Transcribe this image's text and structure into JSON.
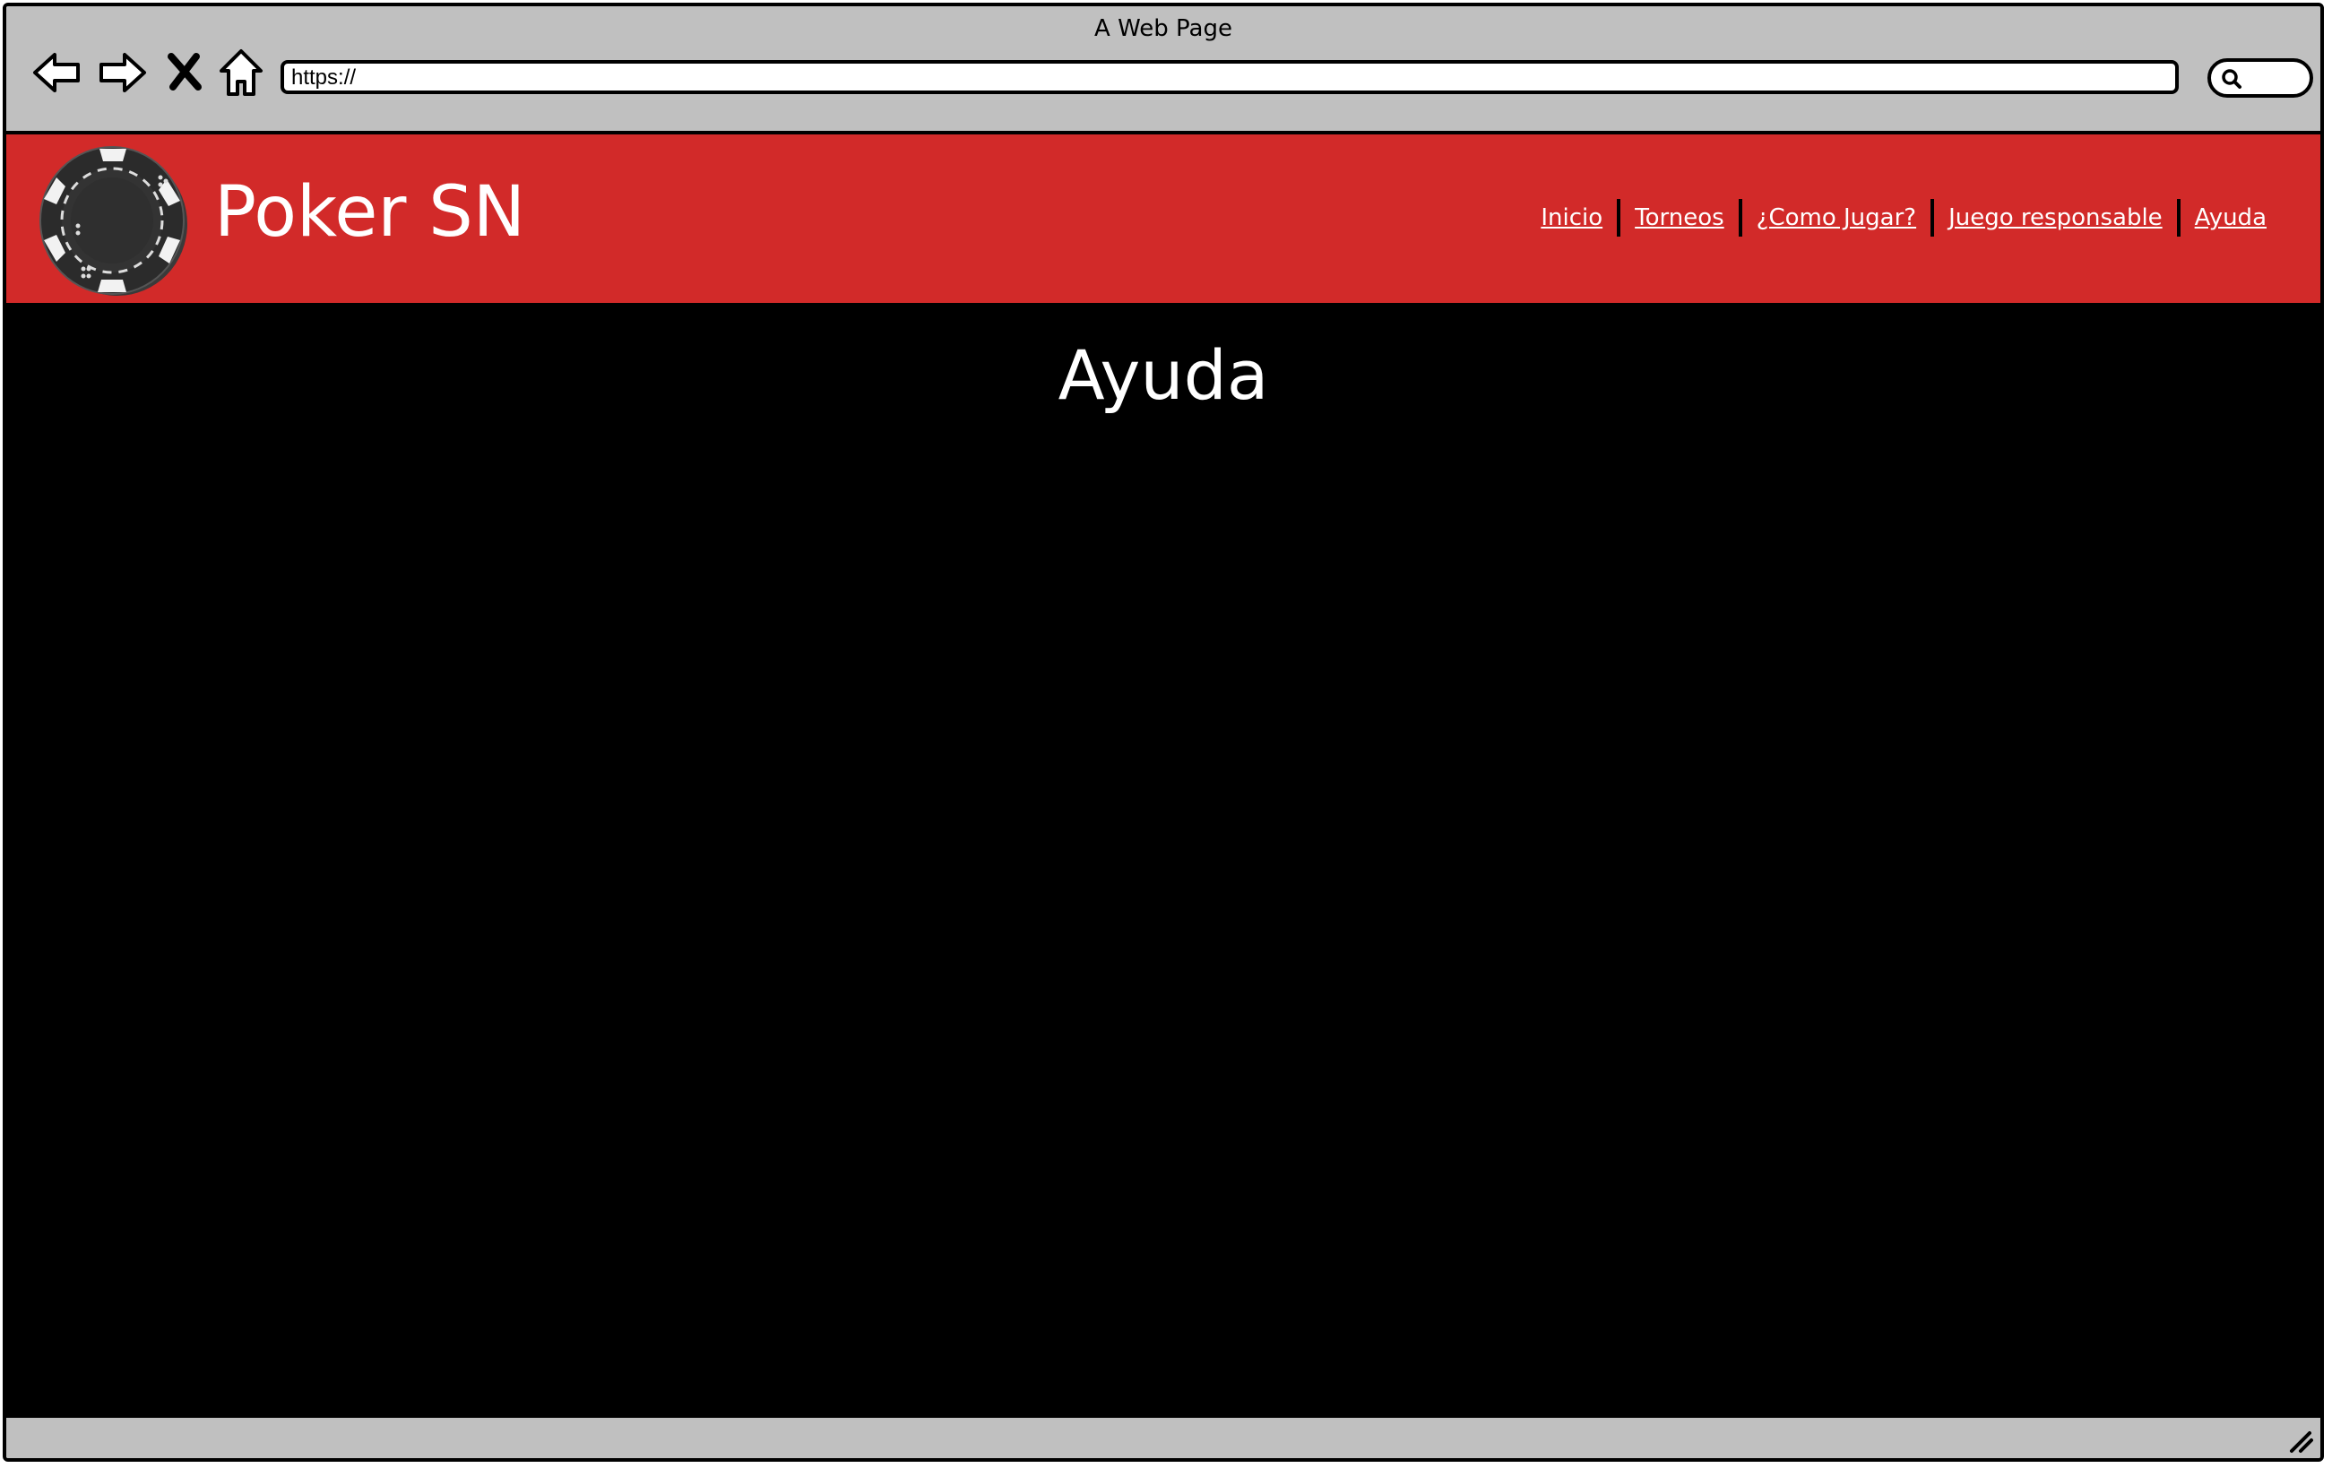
{
  "browser": {
    "window_title": "A Web Page",
    "url": "https://",
    "icons": {
      "back": "arrow-left-icon",
      "forward": "arrow-right-icon",
      "stop": "close-icon",
      "home": "home-icon",
      "search": "search-icon",
      "resize": "resize-grip-icon"
    }
  },
  "site": {
    "title": "Poker SN",
    "logo": "poker-chip-icon",
    "nav": [
      {
        "label": "Inicio"
      },
      {
        "label": "Torneos"
      },
      {
        "label": "¿Como Jugar?"
      },
      {
        "label": "Juego responsable"
      },
      {
        "label": "Ayuda"
      }
    ]
  },
  "main": {
    "heading": "Ayuda"
  },
  "colors": {
    "header_red": "#d22a29",
    "content_bg": "#000000",
    "chrome_gray": "#c0c0c0",
    "text_white": "#ffffff"
  }
}
